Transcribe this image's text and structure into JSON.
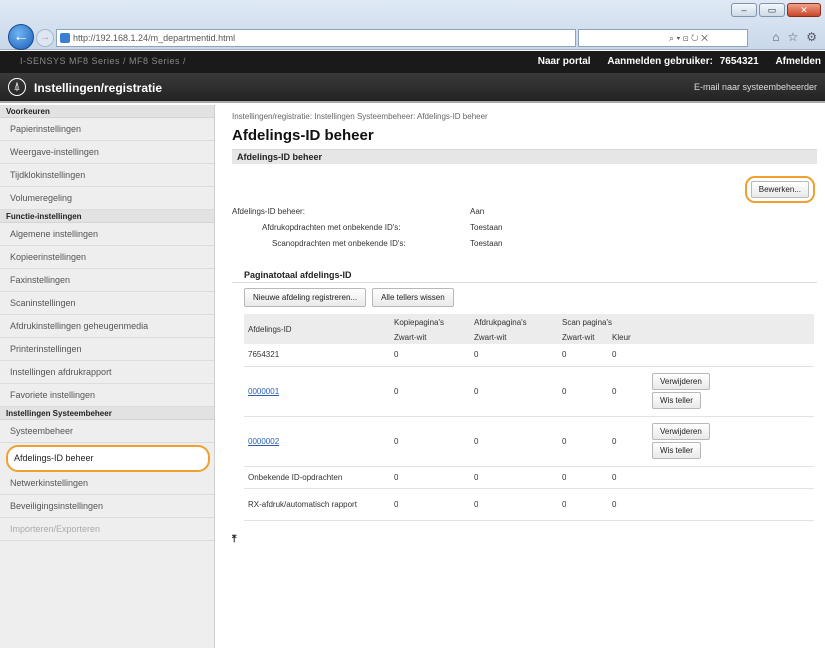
{
  "browser": {
    "url": "http://192.168.1.24/m_departmentid.html",
    "addr_tools": "⌕ ▾ ⊡ ↻ ✕",
    "win_min": "–",
    "win_max": "▭",
    "win_close": "✕"
  },
  "topbar": {
    "device": "I-SENSYS    MF8 Series / MF8 Series /",
    "portal": "Naar portal",
    "login_label": "Aanmelden gebruiker:",
    "login_user": "7654321",
    "logout": "Afmelden"
  },
  "header": {
    "title": "Instellingen/registratie",
    "mail": "E-mail naar systeembeheerder"
  },
  "sidebar": {
    "sections": [
      {
        "title": "Voorkeuren",
        "items": [
          "Papierinstellingen",
          "Weergave-instellingen",
          "Tijdklokinstellingen",
          "Volumeregeling"
        ]
      },
      {
        "title": "Functie-instellingen",
        "items": [
          "Algemene instellingen",
          "Kopieerinstellingen",
          "Faxinstellingen",
          "Scaninstellingen",
          "Afdrukinstellingen geheugenmedia",
          "Printerinstellingen",
          "Instellingen afdrukrapport",
          "Favoriete instellingen"
        ]
      },
      {
        "title": "Instellingen Systeembeheer",
        "items": [
          "Systeembeheer",
          "Afdelings-ID beheer",
          "Netwerkinstellingen",
          "Beveiligingsinstellingen",
          "Importeren/Exporteren"
        ]
      }
    ]
  },
  "main": {
    "breadcrumb": "Instellingen/registratie: Instellingen Systeembeheer: Afdelings-ID beheer",
    "title": "Afdelings-ID beheer",
    "section": "Afdelings-ID beheer",
    "edit_button": "Bewerken...",
    "settings": [
      {
        "label": "Afdelings-ID beheer:",
        "value": "Aan"
      },
      {
        "label": "Afdrukopdrachten met onbekende ID's:",
        "value": "Toestaan"
      },
      {
        "label": "Scanopdrachten met onbekende ID's:",
        "value": "Toestaan"
      }
    ],
    "subhead": "Paginatotaal afdelings-ID",
    "register_button": "Nieuwe afdeling registreren...",
    "clear_all_button": "Alle tellers wissen",
    "table": {
      "col_id": "Afdelings-ID",
      "col_copy": "Kopiepagina's",
      "col_print": "Afdrukpagina's",
      "col_scan": "Scan pagina's",
      "sub_bw": "Zwart-wit",
      "sub_color": "Kleur",
      "rows": [
        {
          "id": "7654321",
          "copy": "0",
          "print": "0",
          "scan_bw": "0",
          "scan_color": "0"
        },
        {
          "id": "0000001",
          "copy": "0",
          "print": "0",
          "scan_bw": "0",
          "scan_color": "0"
        },
        {
          "id": "0000002",
          "copy": "0",
          "print": "0",
          "scan_bw": "0",
          "scan_color": "0"
        },
        {
          "id": "Onbekende ID-opdrachten",
          "copy": "0",
          "print": "0",
          "scan_bw": "0",
          "scan_color": "0"
        },
        {
          "id": "RX-afdruk/automatisch rapport",
          "copy": "0",
          "print": "0",
          "scan_bw": "0",
          "scan_color": "0"
        }
      ],
      "delete_button": "Verwijderen",
      "reset_button": "Wis teller"
    },
    "top_arrow": "⤒"
  }
}
